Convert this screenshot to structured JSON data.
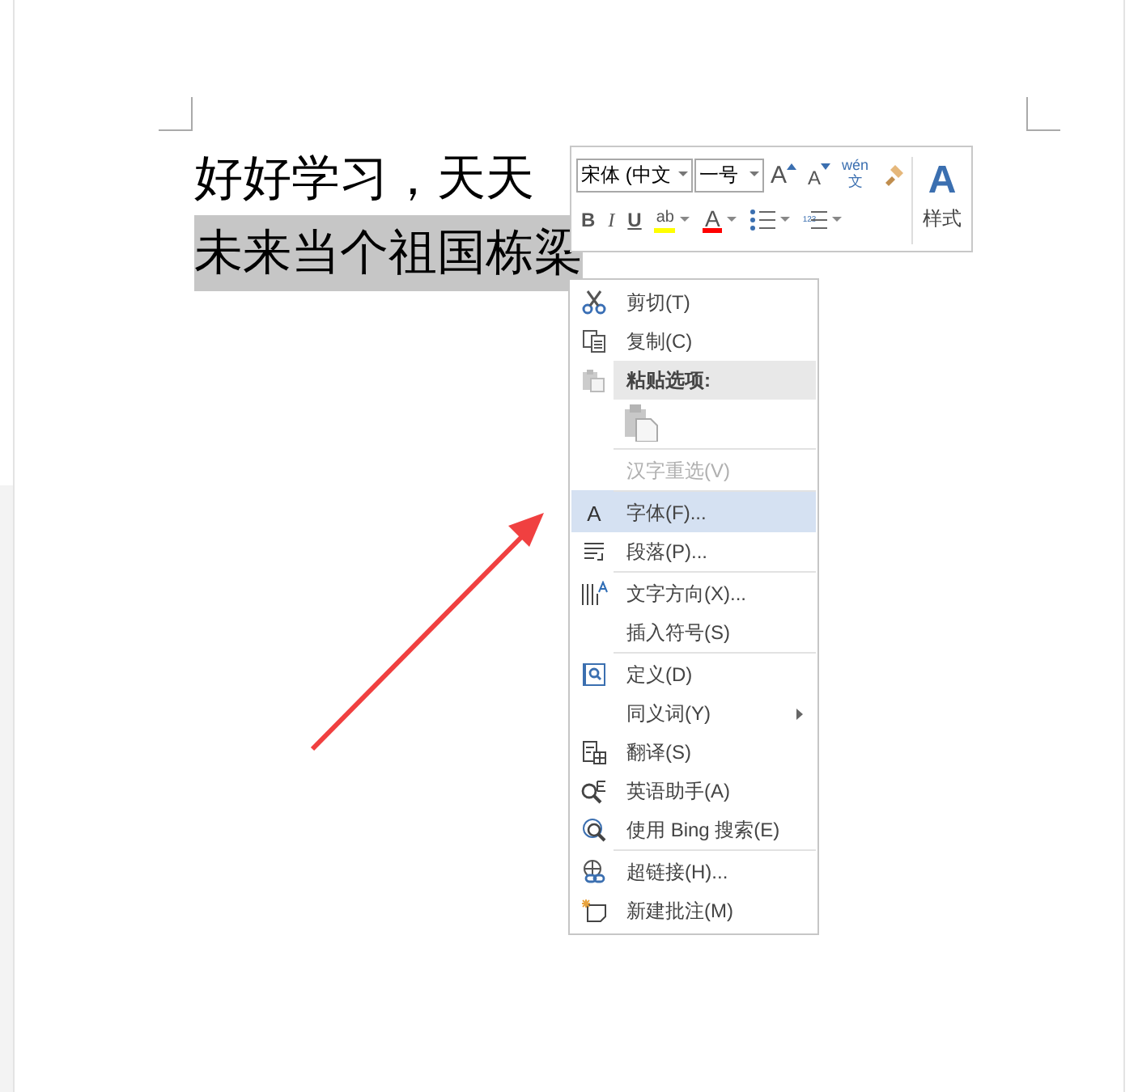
{
  "document": {
    "lines": [
      {
        "text": "好好学习，天天",
        "selected": false
      },
      {
        "text": "未来当个祖国栋梁",
        "selected": true
      }
    ]
  },
  "mini_toolbar": {
    "font_name": "宋体 (中文",
    "font_size": "一号",
    "row1": [
      {
        "kind": "grow",
        "glyph": "A"
      },
      {
        "kind": "shrink",
        "glyph": "A"
      },
      {
        "kind": "phonetic",
        "glyph": "wén",
        "sub": "文"
      },
      {
        "kind": "painter"
      }
    ],
    "row2": [
      {
        "kind": "bold",
        "glyph": "B"
      },
      {
        "kind": "italic",
        "glyph": "I"
      },
      {
        "kind": "underline",
        "glyph": "U"
      },
      {
        "kind": "highlight",
        "glyph": "ab",
        "color": "#ffff00"
      },
      {
        "kind": "fontcolor",
        "glyph": "A",
        "color": "#ff0000"
      },
      {
        "kind": "bullets"
      },
      {
        "kind": "numbering",
        "glyph": "123"
      }
    ],
    "styles": {
      "glyph": "A",
      "label": "样式"
    }
  },
  "context_menu": {
    "items": [
      {
        "kind": "command",
        "label": "剪切(T)",
        "selected": false,
        "disabled": false,
        "submenu": false,
        "separator_before": false
      },
      {
        "kind": "command",
        "label": "复制(C)",
        "selected": false,
        "disabled": false,
        "submenu": false,
        "separator_before": false
      },
      {
        "kind": "header",
        "label": "粘贴选项:"
      },
      {
        "kind": "paste"
      },
      {
        "kind": "command",
        "label": "汉字重选(V)",
        "selected": false,
        "disabled": true,
        "submenu": false,
        "separator_before": true
      },
      {
        "kind": "command",
        "label": "字体(F)...",
        "selected": true,
        "disabled": false,
        "submenu": false,
        "separator_before": true,
        "glyph": "A"
      },
      {
        "kind": "command",
        "label": "段落(P)...",
        "selected": false,
        "disabled": false,
        "submenu": false,
        "separator_before": false
      },
      {
        "kind": "command",
        "label": "文字方向(X)...",
        "selected": false,
        "disabled": false,
        "submenu": false,
        "separator_before": true
      },
      {
        "kind": "command",
        "label": "插入符号(S)",
        "selected": false,
        "disabled": false,
        "submenu": false,
        "separator_before": false
      },
      {
        "kind": "command",
        "label": "定义(D)",
        "selected": false,
        "disabled": false,
        "submenu": false,
        "separator_before": true
      },
      {
        "kind": "command",
        "label": "同义词(Y)",
        "selected": false,
        "disabled": false,
        "submenu": true,
        "separator_before": false
      },
      {
        "kind": "command",
        "label": "翻译(S)",
        "selected": false,
        "disabled": false,
        "submenu": false,
        "separator_before": false
      },
      {
        "kind": "command",
        "label": "英语助手(A)",
        "selected": false,
        "disabled": false,
        "submenu": false,
        "separator_before": false
      },
      {
        "kind": "command",
        "label": "使用 Bing 搜索(E)",
        "selected": false,
        "disabled": false,
        "submenu": false,
        "separator_before": false
      },
      {
        "kind": "command",
        "label": "超链接(H)...",
        "selected": false,
        "disabled": false,
        "submenu": false,
        "separator_before": true
      },
      {
        "kind": "command",
        "label": "新建批注(M)",
        "selected": false,
        "disabled": false,
        "submenu": false,
        "separator_before": false
      }
    ]
  }
}
